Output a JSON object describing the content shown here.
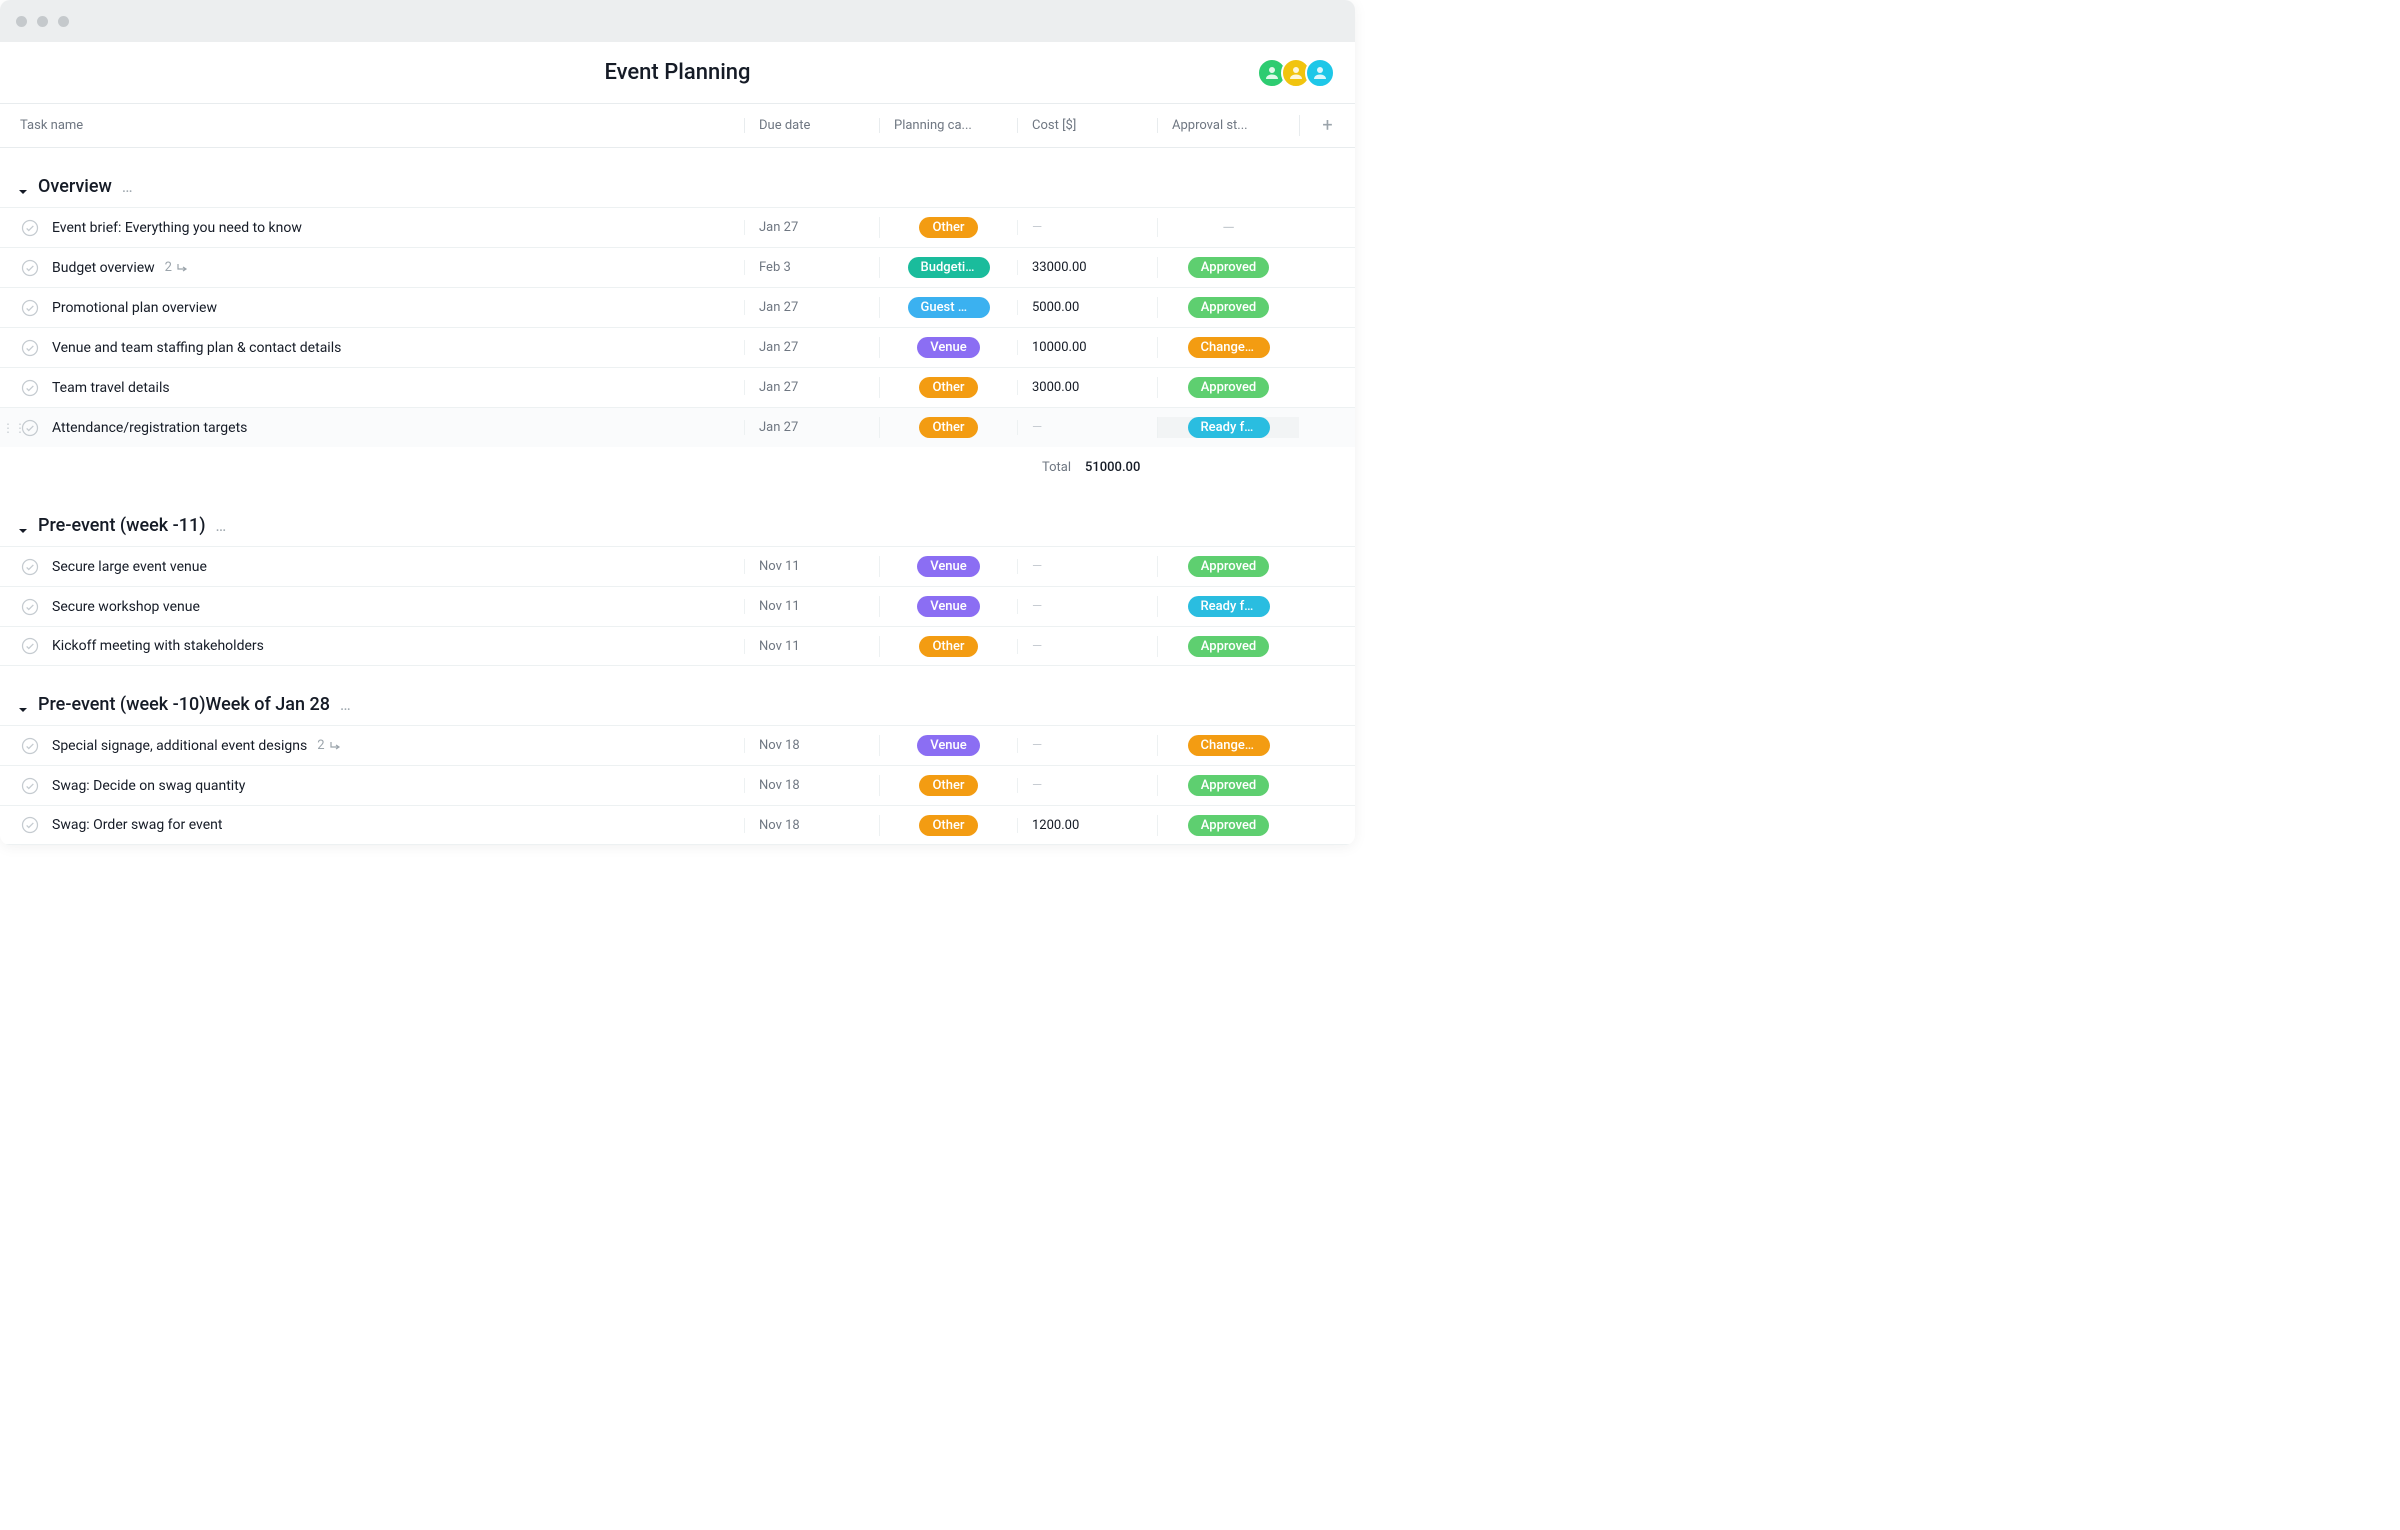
{
  "title": "Event Planning",
  "avatars": [
    {
      "bg": "#2ecc71"
    },
    {
      "bg": "#f1c40f"
    },
    {
      "bg": "#1ec7e8"
    }
  ],
  "columns": {
    "name": "Task name",
    "due": "Due date",
    "category": "Planning ca...",
    "cost": "Cost [$]",
    "approval": "Approval st..."
  },
  "pill_colors": {
    "Other": "#f39c12",
    "Budgeting": "#1abc9c",
    "Guest m...": "#3bb1f0",
    "Venue": "#8b6ef3",
    "Approved": "#5ecf70",
    "Changes...": "#f39c12",
    "Ready fo...": "#2abde0"
  },
  "sections": [
    {
      "title": "Overview",
      "tasks": [
        {
          "name": "Event brief: Everything you need to know",
          "due": "Jan 27",
          "cat": "Other",
          "cost": "",
          "appr": ""
        },
        {
          "name": "Budget overview",
          "subtasks": "2",
          "due": "Feb 3",
          "cat": "Budgeting",
          "cost": "33000.00",
          "appr": "Approved"
        },
        {
          "name": "Promotional plan overview",
          "due": "Jan 27",
          "cat": "Guest m...",
          "cost": "5000.00",
          "appr": "Approved"
        },
        {
          "name": "Venue and team staffing plan & contact details",
          "due": "Jan 27",
          "cat": "Venue",
          "cost": "10000.00",
          "appr": "Changes..."
        },
        {
          "name": "Team travel details",
          "due": "Jan 27",
          "cat": "Other",
          "cost": "3000.00",
          "appr": "Approved"
        },
        {
          "name": "Attendance/registration targets",
          "due": "Jan 27",
          "cat": "Other",
          "cost": "",
          "appr": "Ready fo...",
          "hover": true
        }
      ],
      "total_label": "Total",
      "total_value": "51000.00"
    },
    {
      "title": "Pre-event (week -11)",
      "tasks": [
        {
          "name": "Secure large event venue",
          "due": "Nov 11",
          "cat": "Venue",
          "cost": "",
          "appr": "Approved"
        },
        {
          "name": "Secure workshop venue",
          "due": "Nov 11",
          "cat": "Venue",
          "cost": "",
          "appr": "Ready fo..."
        },
        {
          "name": "Kickoff meeting with stakeholders",
          "due": "Nov 11",
          "cat": "Other",
          "cost": "",
          "appr": "Approved"
        }
      ]
    },
    {
      "title": "Pre-event (week -10)Week of Jan 28",
      "tasks": [
        {
          "name": "Special signage, additional event designs",
          "subtasks": "2",
          "due": "Nov 18",
          "cat": "Venue",
          "cost": "",
          "appr": "Changes..."
        },
        {
          "name": "Swag: Decide on swag quantity",
          "due": "Nov 18",
          "cat": "Other",
          "cost": "",
          "appr": "Approved"
        },
        {
          "name": "Swag: Order swag for event",
          "due": "Nov 18",
          "cat": "Other",
          "cost": "1200.00",
          "appr": "Approved"
        }
      ]
    }
  ]
}
